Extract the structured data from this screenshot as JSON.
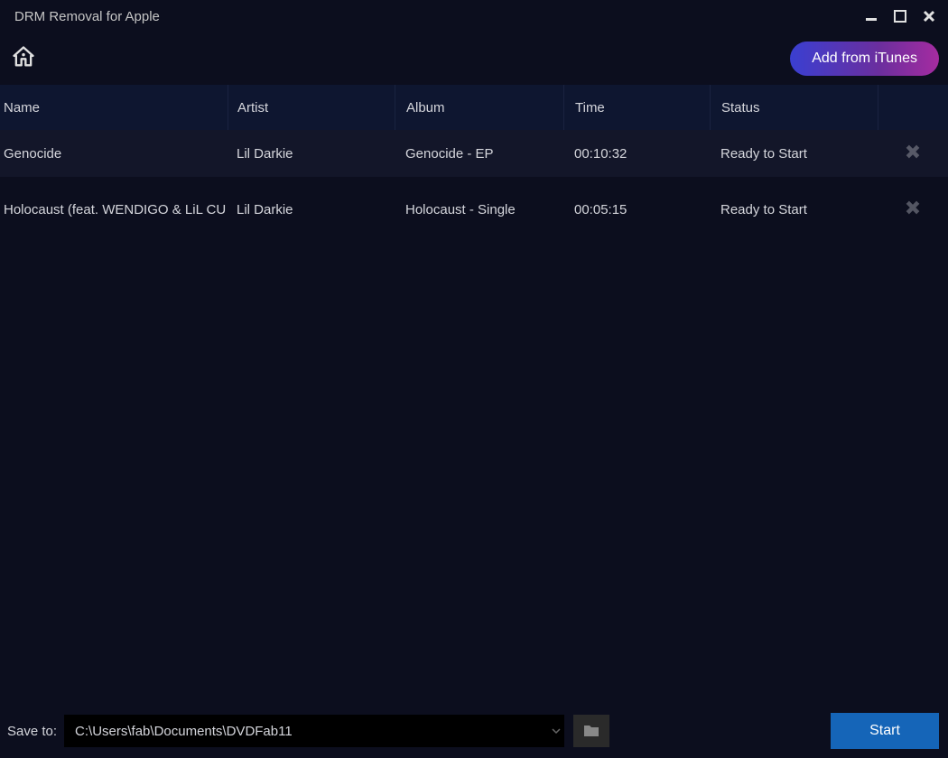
{
  "title": "DRM Removal for Apple",
  "toolbar": {
    "add_button": "Add from iTunes"
  },
  "columns": {
    "name": "Name",
    "artist": "Artist",
    "album": "Album",
    "time": "Time",
    "status": "Status"
  },
  "rows": [
    {
      "name": "Genocide",
      "artist": "Lil Darkie",
      "album": "Genocide - EP",
      "time": "00:10:32",
      "status": "Ready to Start"
    },
    {
      "name": "Holocaust (feat. WENDIGO & LiL CU",
      "artist": "Lil Darkie",
      "album": "Holocaust - Single",
      "time": "00:05:15",
      "status": "Ready to Start"
    }
  ],
  "footer": {
    "save_label": "Save to:",
    "path": "C:\\Users\\fab\\Documents\\DVDFab11",
    "start_button": "Start"
  }
}
